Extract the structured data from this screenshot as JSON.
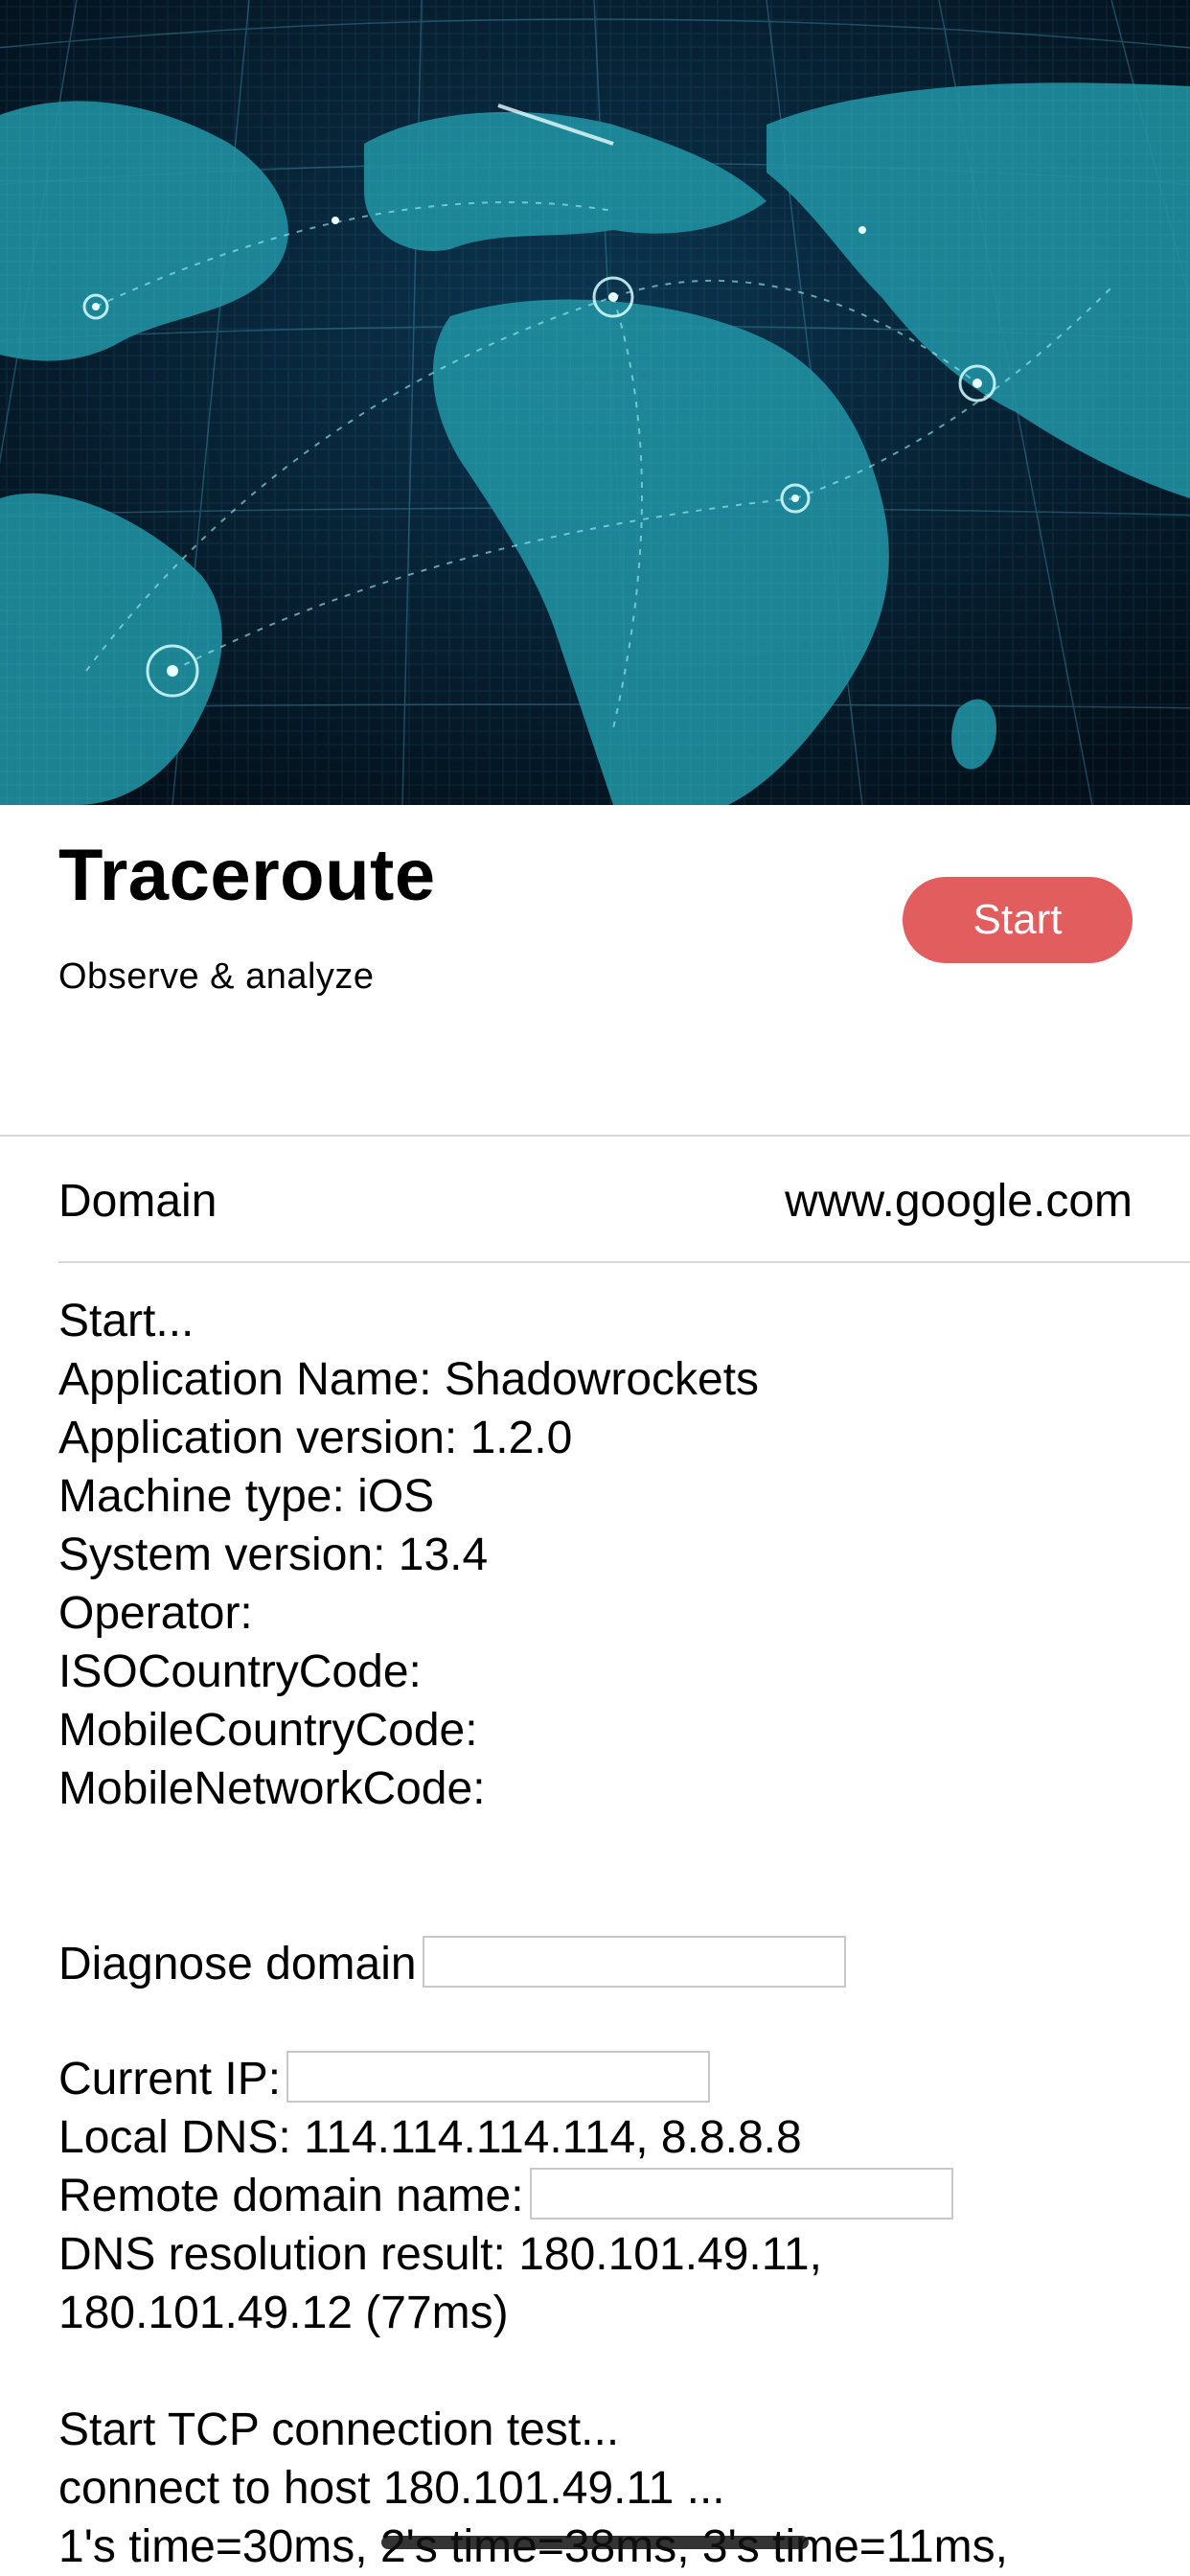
{
  "header": {
    "title": "Traceroute",
    "subtitle": "Observe & analyze",
    "start_button": "Start"
  },
  "domain_row": {
    "label": "Domain",
    "value": "www.google.com"
  },
  "log": {
    "lines": [
      "Start...",
      "Application Name: Shadowrockets",
      "Application version: 1.2.0",
      "Machine type: iOS",
      "System version: 13.4",
      "Operator:",
      "ISOCountryCode:",
      "MobileCountryCode:",
      "MobileNetworkCode:"
    ],
    "diagnose_domain": "Diagnose domain",
    "current_ip": "Current IP:",
    "local_dns": "Local DNS: 114.114.114.114, 8.8.8.8",
    "remote_domain": "Remote domain name:",
    "dns_result_1": "DNS resolution result: 180.101.49.11,",
    "dns_result_2": "180.101.49.12 (77ms)",
    "tcp_start": "Start TCP connection test...",
    "tcp_connect": "connect to host 180.101.49.11 ...",
    "tcp_times": "1's time=30ms, 2's time=38ms, 3's time=11ms,"
  },
  "colors": {
    "accent": "#e25d5d",
    "hero_bg": "#061a2a",
    "hero_land": "#2fb8c4"
  },
  "icons": {
    "hero": "world-map-network-image"
  }
}
